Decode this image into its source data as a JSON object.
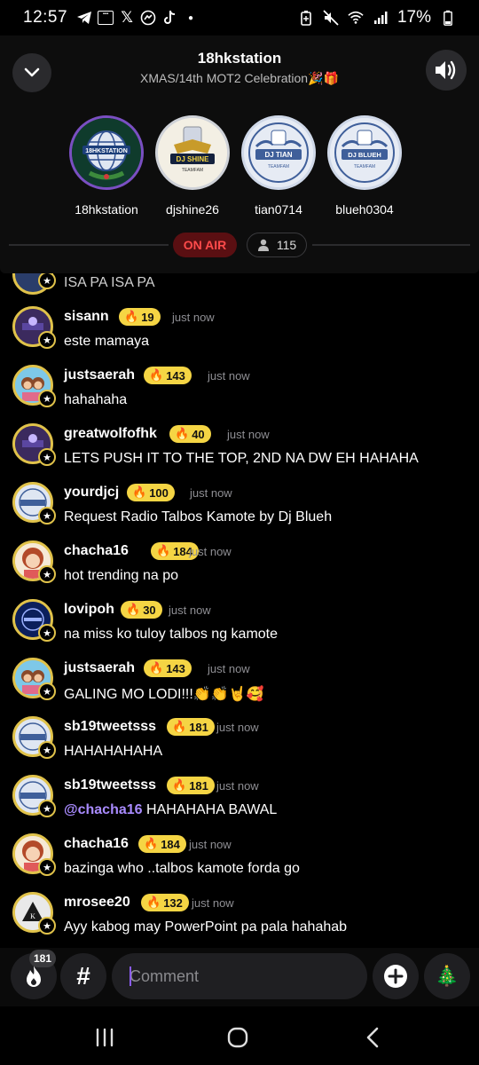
{
  "status_bar": {
    "time": "12:57",
    "battery": "17%",
    "left_icons": [
      "telegram-icon",
      "news-icon",
      "x-icon",
      "messenger-icon",
      "tiktok-icon",
      "dot-icon"
    ],
    "right_icons": [
      "battery-saver-icon",
      "mute-icon",
      "wifi-icon",
      "signal-icon",
      "battery-icon"
    ]
  },
  "header": {
    "title": "18hkstation",
    "subtitle": "XMAS/14th MOT2 Celebration🎉🎁",
    "hosts": [
      {
        "name": "18hkstation",
        "logo_text": "18HKSTATION"
      },
      {
        "name": "djshine26",
        "logo_text": "DJ SHINE"
      },
      {
        "name": "tian0714",
        "logo_text": "DJ TIAN"
      },
      {
        "name": "blueh0304",
        "logo_text": "DJ BLUEH"
      }
    ],
    "on_air_label": "ON AIR",
    "listener_count": "115"
  },
  "chat": {
    "partial_message": "ISA PA ISA PA",
    "messages": [
      {
        "username": "sisann",
        "level": "19",
        "time": "just now",
        "text": "este mamaya"
      },
      {
        "username": "justsaerah",
        "level": "143",
        "time": "just now",
        "text": "hahahaha"
      },
      {
        "username": "greatwolfofhk",
        "level": "40",
        "time": "just now",
        "text": "LETS PUSH IT TO THE TOP, 2ND NA DW EH HAHAHA"
      },
      {
        "username": "yourdjcj",
        "level": "100",
        "time": "just now",
        "text": "Request Radio Talbos Kamote by Dj Blueh"
      },
      {
        "username": "chacha16",
        "level": "184",
        "time": "just now",
        "text": "hot trending na po"
      },
      {
        "username": "lovipoh",
        "level": "30",
        "time": "just now",
        "text": "na miss ko tuloy talbos ng kamote"
      },
      {
        "username": "justsaerah",
        "level": "143",
        "time": "just now",
        "text": "GALING MO LODI!!!👏👏🤘🥰"
      },
      {
        "username": "sb19tweetsss",
        "level": "181",
        "time": "just now",
        "text": "HAHAHAHAHA"
      },
      {
        "username": "sb19tweetsss",
        "level": "181",
        "time": "just now",
        "mention": "@chacha16",
        "text": " HAHAHAHA BAWAL"
      },
      {
        "username": "chacha16",
        "level": "184",
        "time": "just now",
        "text": "bazinga who ..talbos kamote forda go"
      },
      {
        "username": "mrosee20",
        "level": "132",
        "time": "just now",
        "text": "Ayy kabog may PowerPoint pa pala hahahab"
      }
    ]
  },
  "bottom_bar": {
    "fire_count": "181",
    "hash_label": "#",
    "comment_placeholder": "Comment",
    "tree_emoji": "🎄"
  },
  "colors": {
    "accent_purple": "#8b5cf6",
    "on_air_red": "#ff4b4b",
    "level_yellow": "#f5d544",
    "mention_purple": "#a98bff"
  }
}
